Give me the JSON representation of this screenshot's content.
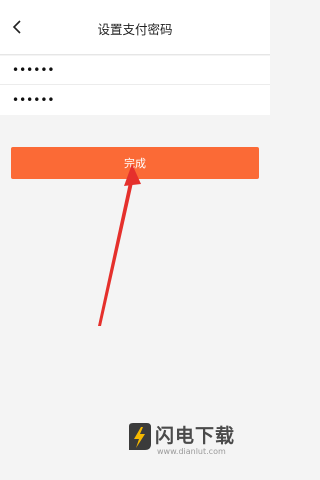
{
  "header": {
    "title": "设置支付密码",
    "back_icon": "chevron-left-icon"
  },
  "password_fields": [
    {
      "value": "••••••"
    },
    {
      "value": "••••••"
    }
  ],
  "done_button": {
    "label": "完成",
    "color": "#fb6a36"
  },
  "annotation": {
    "arrow_color": "#e5302c"
  },
  "watermark": {
    "name": "闪电下载",
    "url": "www.dianlut.com"
  }
}
